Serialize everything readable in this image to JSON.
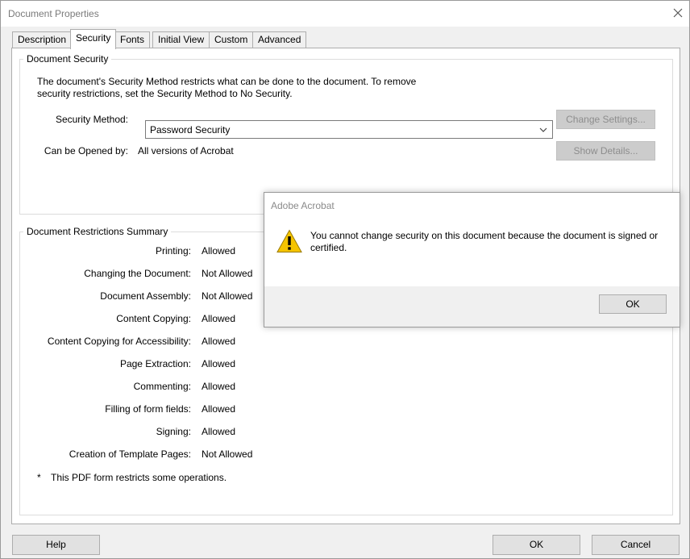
{
  "window": {
    "title": "Document Properties",
    "close_icon": "close-icon"
  },
  "tabs": [
    {
      "label": "Description",
      "active": false
    },
    {
      "label": "Security",
      "active": true
    },
    {
      "label": "Fonts",
      "active": false
    },
    {
      "label": "Initial View",
      "active": false
    },
    {
      "label": "Custom",
      "active": false
    },
    {
      "label": "Advanced",
      "active": false
    }
  ],
  "document_security": {
    "legend": "Document Security",
    "description_line1": "The document's Security Method restricts what can be done to the document. To remove",
    "description_line2": "security restrictions, set the Security Method to No Security.",
    "security_method_label": "Security Method:",
    "security_method_value": "Password Security",
    "opened_by_label": "Can be Opened by:",
    "opened_by_value": "All versions of Acrobat",
    "change_settings_button": "Change Settings...",
    "show_details_button": "Show Details..."
  },
  "restrictions": {
    "legend": "Document Restrictions Summary",
    "rows": [
      {
        "label": "Printing:",
        "value": "Allowed"
      },
      {
        "label": "Changing the Document:",
        "value": "Not Allowed"
      },
      {
        "label": "Document Assembly:",
        "value": "Not Allowed"
      },
      {
        "label": "Content Copying:",
        "value": "Allowed"
      },
      {
        "label": "Content Copying for Accessibility:",
        "value": "Allowed"
      },
      {
        "label": "Page Extraction:",
        "value": "Allowed"
      },
      {
        "label": "Commenting:",
        "value": "Allowed"
      },
      {
        "label": "Filling of form fields:",
        "value": "Allowed"
      },
      {
        "label": "Signing:",
        "value": "Allowed"
      },
      {
        "label": "Creation of Template Pages:",
        "value": "Not Allowed"
      }
    ],
    "footnote_mark": "*",
    "footnote_text": "This PDF form restricts some operations."
  },
  "footer": {
    "help_button": "Help",
    "ok_button": "OK",
    "cancel_button": "Cancel"
  },
  "dialog": {
    "title": "Adobe Acrobat",
    "message": "You cannot change security on this document because the document is signed or certified.",
    "ok_button": "OK",
    "icon": "warning-icon"
  }
}
